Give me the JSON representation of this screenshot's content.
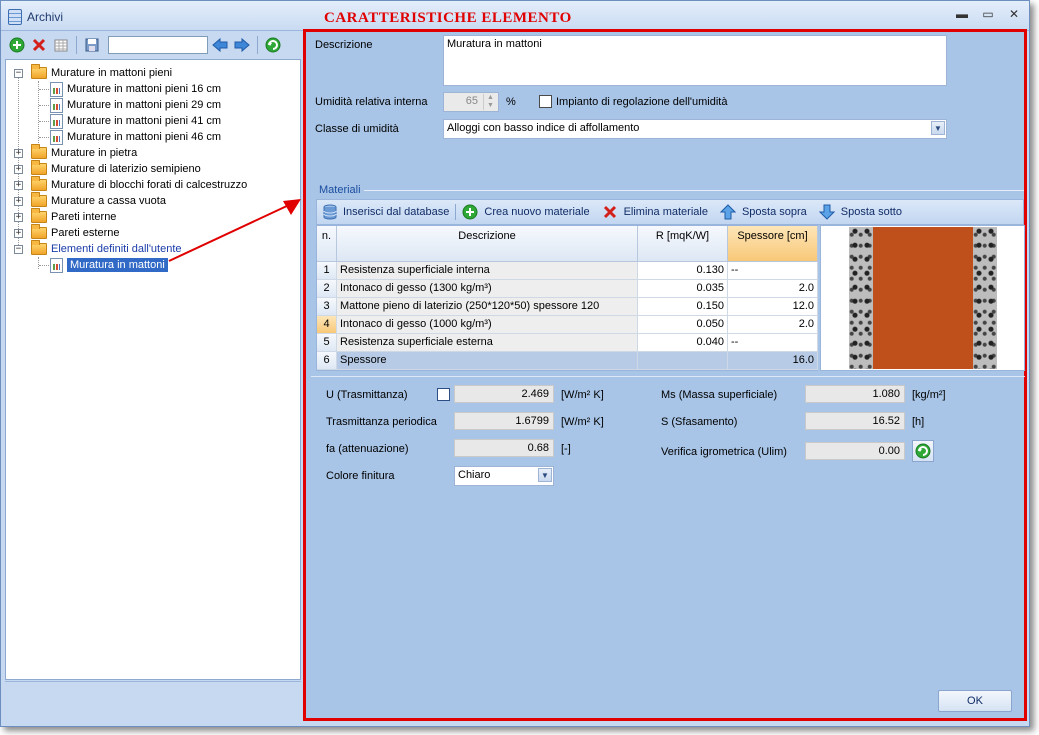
{
  "window": {
    "title": "Archivi",
    "section_title": "CARATTERISTICHE  ELEMENTO"
  },
  "left_toolbar": {
    "search_value": ""
  },
  "tree": [
    {
      "label": "Murature in mattoni pieni",
      "type": "folder",
      "expanded": true,
      "children": [
        "Murature in mattoni pieni 16 cm",
        "Murature in mattoni pieni 29 cm",
        "Murature in mattoni pieni 41 cm",
        "Murature in mattoni pieni 46 cm"
      ]
    },
    {
      "label": "Murature in pietra",
      "type": "folder",
      "expanded": false
    },
    {
      "label": "Murature di laterizio semipieno",
      "type": "folder",
      "expanded": false
    },
    {
      "label": "Murature di blocchi forati di calcestruzzo",
      "type": "folder",
      "expanded": false
    },
    {
      "label": "Murature a cassa vuota",
      "type": "folder",
      "expanded": false
    },
    {
      "label": "Pareti interne",
      "type": "folder",
      "expanded": false
    },
    {
      "label": "Pareti esterne",
      "type": "folder",
      "expanded": false
    },
    {
      "label": "Elementi definiti dall'utente",
      "type": "folder",
      "expanded": true,
      "children": [
        "Muratura in mattoni"
      ]
    }
  ],
  "form": {
    "descrizione_label": "Descrizione",
    "descrizione_value": "Muratura in mattoni",
    "umidita_label": "Umidità relativa interna",
    "umidita_value": "65",
    "umidita_unit": "%",
    "impianto_label": "Impianto di regolazione dell'umidità",
    "classe_label": "Classe di umidità",
    "classe_value": "Alloggi con basso indice di affollamento"
  },
  "materiali": {
    "group_title": "Materiali",
    "toolbar": {
      "inserisci": "Inserisci dal database",
      "crea": "Crea nuovo materiale",
      "elimina": "Elimina materiale",
      "sopra": "Sposta sopra",
      "sotto": "Sposta sotto"
    },
    "columns": {
      "n": "n.",
      "descrizione": "Descrizione",
      "r": "R [mqK/W]",
      "spessore": "Spessore [cm]"
    },
    "rows": [
      {
        "n": "1",
        "descrizione": "Resistenza superficiale interna",
        "r": "0.130",
        "spessore": "--"
      },
      {
        "n": "2",
        "descrizione": "Intonaco di gesso (1300 kg/m³)",
        "r": "0.035",
        "spessore": "2.0"
      },
      {
        "n": "3",
        "descrizione": "Mattone pieno di laterizio (250*120*50) spessore 120",
        "r": "0.150",
        "spessore": "12.0"
      },
      {
        "n": "4",
        "descrizione": "Intonaco di gesso (1000 kg/m³)",
        "r": "0.050",
        "spessore": "2.0"
      },
      {
        "n": "5",
        "descrizione": "Resistenza superficiale esterna",
        "r": "0.040",
        "spessore": "--"
      },
      {
        "n": "6",
        "descrizione": "Spessore",
        "r": "",
        "spessore": "16.0"
      }
    ]
  },
  "results": {
    "u_label": "U (Trasmittanza)",
    "u_value": "2.469",
    "u_unit": "[W/m² K]",
    "tp_label": "Trasmittanza periodica",
    "tp_value": "1.6799",
    "tp_unit": "[W/m² K]",
    "fa_label": "fa (attenuazione)",
    "fa_value": "0.68",
    "fa_unit": "[-]",
    "colore_label": "Colore finitura",
    "colore_value": "Chiaro",
    "ms_label": "Ms (Massa superficiale)",
    "ms_value": "1.080",
    "ms_unit": "[kg/m²]",
    "s_label": "S (Sfasamento)",
    "s_value": "16.52",
    "s_unit": "[h]",
    "vi_label": "Verifica igrometrica (Ulim)",
    "vi_value": "0.00"
  },
  "ok_label": "OK",
  "colors": {
    "accent_red": "#e00000",
    "panel_blue": "#a8c4e6",
    "brick": "#c0501b"
  }
}
